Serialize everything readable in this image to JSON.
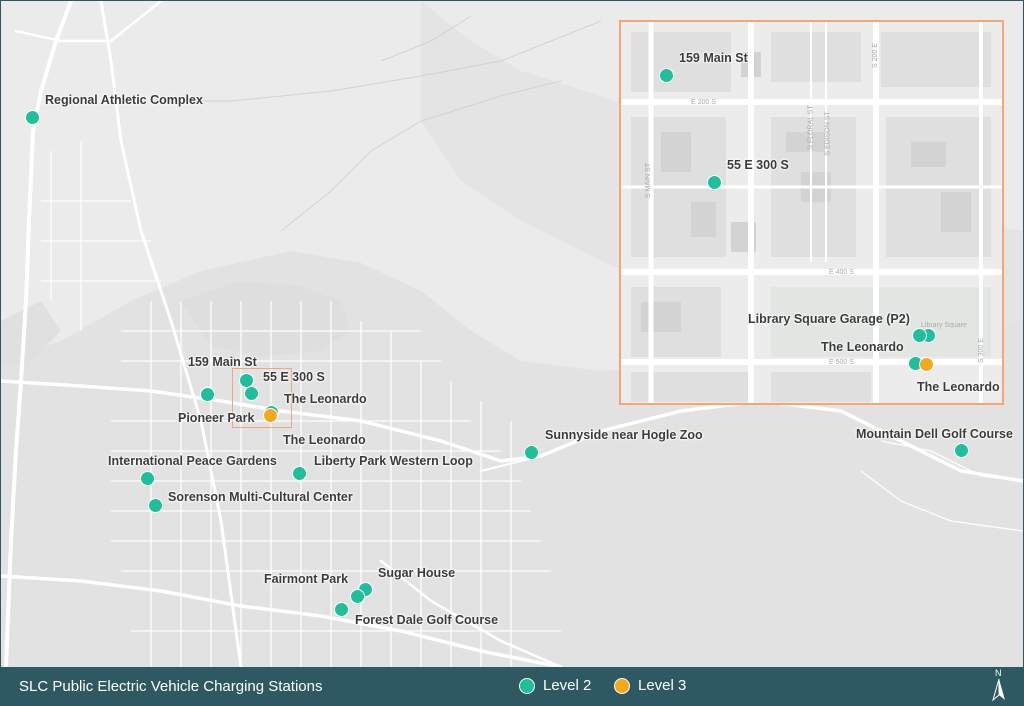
{
  "title": "SLC Public Electric Vehicle Charging Stations",
  "legend": {
    "level2": {
      "label": "Level 2",
      "color": "#1fbf9b"
    },
    "level3": {
      "label": "Level 3",
      "color": "#f4a81c"
    }
  },
  "north_arrow": {
    "label": "N"
  },
  "colors": {
    "footer": "#2e5862",
    "inset_border": "#f2a679",
    "roads": "#ffffff",
    "terrain": "#dcdcdc",
    "background": "#eaeaea"
  },
  "main_labels": [
    "Regional Athletic Complex",
    "159 Main St",
    "55 E 300 S",
    "The Leonardo",
    "Pioneer Park",
    "The Leonardo",
    "International Peace Gardens",
    "Liberty Park Western Loop",
    "Sorenson Multi-Cultural Center",
    "Sunnyside near Hogle Zoo",
    "Mountain Dell Golf Course",
    "Fairmont Park",
    "Sugar House",
    "Forest Dale Golf Course"
  ],
  "inset_labels": [
    "159 Main St",
    "55 E 300 S",
    "Library Square Garage (P2)",
    "The Leonardo",
    "The Leonardo"
  ],
  "inset_streets": [
    "E 200 S",
    "E 400 S",
    "E 500 S",
    "S MAIN ST",
    "S FLORAL ST",
    "S EDISON ST",
    "S 200 E",
    "S 300 E",
    "Library Square"
  ]
}
